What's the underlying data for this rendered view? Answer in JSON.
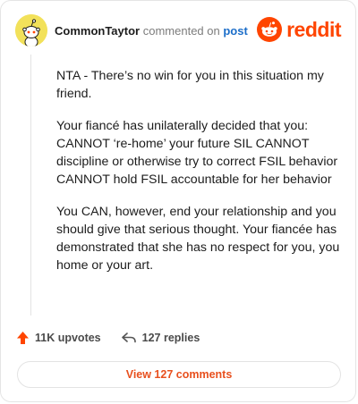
{
  "header": {
    "username": "CommonTaytor",
    "commented_text": "commented on",
    "post_link": "post",
    "avatar_icon": "snoo-avatar-icon",
    "avatar_bg": "#f2e15a"
  },
  "brand": {
    "name": "reddit",
    "icon": "reddit-logo-icon",
    "color": "#ff4500"
  },
  "comment": {
    "paragraphs": [
      "NTA - There’s no win for you in this situation my friend.",
      "Your fiancé has unilaterally decided that you: CANNOT ‘re-home’ your future SIL CANNOT discipline or otherwise try to correct FSIL behavior CANNOT hold FSIL accountable for her behavior",
      "You CAN, however, end your relationship and you should give that serious thought. Your fiancée has demonstrated that she has no respect for you, you home or your art."
    ]
  },
  "actions": {
    "upvotes": "11K upvotes",
    "upvote_icon": "upvote-arrow-icon",
    "replies": "127 replies",
    "reply_icon": "reply-arrow-icon",
    "upvote_color": "#ff4500"
  },
  "view_button": {
    "label": "View 127 comments",
    "color": "#e8501e"
  }
}
